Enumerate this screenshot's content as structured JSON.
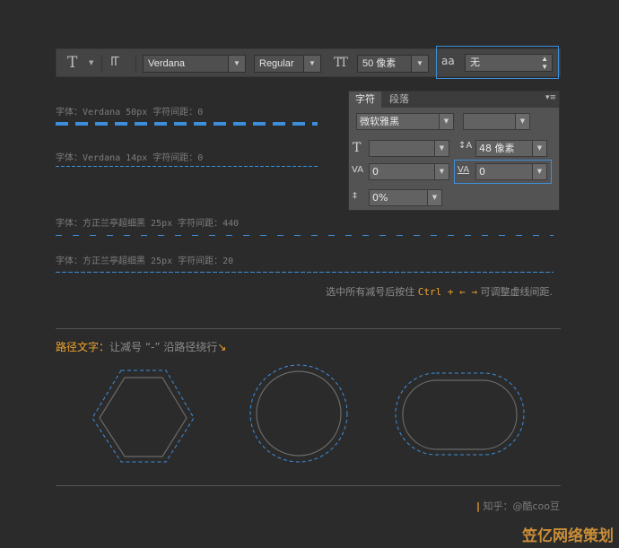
{
  "options_bar": {
    "text_tool_icon": "T",
    "orient_icon": "IT",
    "font_family": "Verdana",
    "font_style": "Regular",
    "size_icon": "TT",
    "font_size": "50 像素",
    "aa_icon": "aa",
    "anti_alias": "无"
  },
  "char_panel": {
    "tabs": [
      "字符",
      "段落"
    ],
    "font_family": "微软雅黑",
    "font_style": "",
    "font_size": "",
    "leading": "48 像素",
    "kerning": "0",
    "tracking": "0",
    "vertical_scale": "0%"
  },
  "samples": [
    {
      "caption": "字体：Verdana  50px  字符间距：0"
    },
    {
      "caption": "字体：Verdana  14px  字符间距：0"
    },
    {
      "caption": "字体：方正兰亭超细黑  25px  字符间距：440"
    },
    {
      "caption": "字体：方正兰亭超细黑  25px  字符间距：20"
    }
  ],
  "hint": {
    "prefix": "选中所有减号后按住",
    "keys": "Ctrl + ← →",
    "suffix": "可调整虚线间距."
  },
  "path_section": {
    "title_highlight": "路径文字：",
    "title_rest": "让减号 “-” 沿路径绕行",
    "arrow": "↘"
  },
  "credit": {
    "bar": "|",
    "text": "知乎：@酷coo豆"
  },
  "watermark": "笠亿网络策划",
  "colors": {
    "accent_blue": "#3d8fdc",
    "accent_orange": "#f0a32c",
    "background": "#2b2b2b"
  }
}
